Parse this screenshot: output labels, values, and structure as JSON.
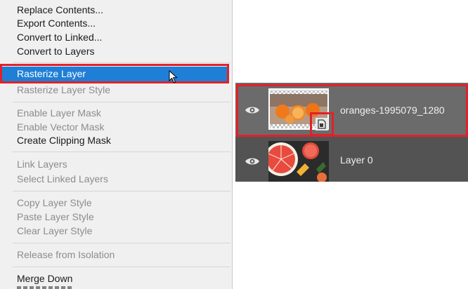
{
  "context_menu": {
    "items": [
      {
        "label": "Replace Contents...",
        "enabled": true
      },
      {
        "label": "Export Contents...",
        "enabled": true
      },
      {
        "label": "Convert to Linked...",
        "enabled": true
      },
      {
        "label": "Convert to Layers",
        "enabled": true
      },
      {
        "label": "Rasterize Layer",
        "enabled": true,
        "highlighted": true
      },
      {
        "label": "Rasterize Layer Style",
        "enabled": false
      },
      {
        "label": "Enable Layer Mask",
        "enabled": false
      },
      {
        "label": "Enable Vector Mask",
        "enabled": false
      },
      {
        "label": "Create Clipping Mask",
        "enabled": true
      },
      {
        "label": "Link Layers",
        "enabled": false
      },
      {
        "label": "Select Linked Layers",
        "enabled": false
      },
      {
        "label": "Copy Layer Style",
        "enabled": false
      },
      {
        "label": "Paste Layer Style",
        "enabled": false
      },
      {
        "label": "Clear Layer Style",
        "enabled": false
      },
      {
        "label": "Release from Isolation",
        "enabled": false
      },
      {
        "label": "Merge Down",
        "enabled": true
      }
    ]
  },
  "layers_panel": {
    "layers": [
      {
        "name": "oranges-1995079_1280",
        "selected": true,
        "smart_object": true,
        "visible": true
      },
      {
        "name": "Layer 0",
        "selected": false,
        "smart_object": false,
        "visible": true
      }
    ]
  },
  "colors": {
    "highlight": "#1f7fd6",
    "annotation_red": "#e3202a",
    "panel_bg": "#535353",
    "selected_row": "#6b6b6b"
  }
}
